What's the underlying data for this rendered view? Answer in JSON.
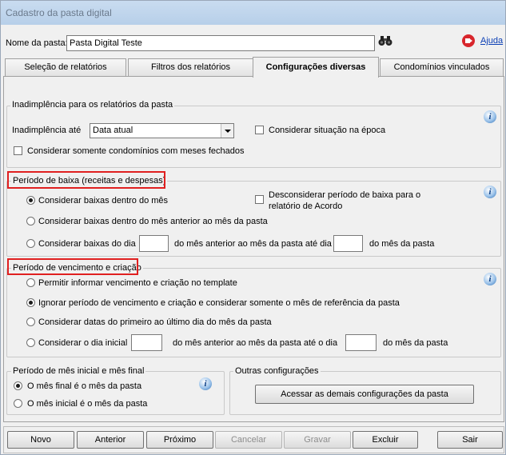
{
  "window": {
    "title": "Cadastro da pasta digital"
  },
  "header": {
    "folder_name_label": "Nome da pasta:",
    "folder_name_value": "Pasta Digital Teste",
    "help_label": "Ajuda"
  },
  "tabs": [
    {
      "label": "Seleção de relatórios"
    },
    {
      "label": "Filtros dos relatórios"
    },
    {
      "label": "Configurações diversas"
    },
    {
      "label": "Condomínios vinculados"
    }
  ],
  "inadimplencia": {
    "group_title": "Inadimplência para os relatórios da pasta",
    "until_label": "Inadimplência até",
    "until_value": "Data atual",
    "consider_situation": "Considerar situação na época",
    "only_closed_months": "Considerar somente condomínios com meses fechados"
  },
  "baixa": {
    "group_title": "Período de baixa (receitas e despesas)",
    "opt_within_month": "Considerar baixas dentro do mês",
    "opt_prev_month": "Considerar baixas dentro do mês anterior ao mês da pasta",
    "opt_from_day": "Considerar baixas do dia",
    "mid_text": "do mês anterior ao mês da pasta até dia",
    "end_text": "do mês da pasta",
    "disregard_line1": "Desconsiderar período de baixa para o",
    "disregard_line2": "relatório de Acordo"
  },
  "vencimento": {
    "group_title": "Período de vencimento e criação",
    "opt_template": "Permitir informar vencimento e criação no template",
    "opt_ignore": "Ignorar período de vencimento e criação e considerar somente o mês de referência da pasta",
    "opt_first_last": "Considerar datas do primeiro ao último dia do mês da pasta",
    "opt_initial_day": "Considerar o dia inicial",
    "mid_text": "do mês anterior ao mês da pasta até o dia",
    "end_text": "do mês da pasta"
  },
  "periodo_mes": {
    "group_title": "Período de mês inicial e mês final",
    "opt_final": "O mês final é o mês da pasta",
    "opt_initial": "O mês inicial é o mês da pasta"
  },
  "outras": {
    "group_title": "Outras configurações",
    "access_button": "Acessar as demais configurações da pasta"
  },
  "footer": {
    "new": "Novo",
    "previous": "Anterior",
    "next": "Próximo",
    "cancel": "Cancelar",
    "save": "Gravar",
    "delete": "Excluir",
    "exit": "Sair"
  },
  "colors": {
    "highlight_border": "#e02020",
    "link": "#0b3fb5",
    "help_icon": "#d8262c"
  },
  "icons": [
    "binoculars-icon",
    "help-video-icon",
    "info-icon"
  ]
}
